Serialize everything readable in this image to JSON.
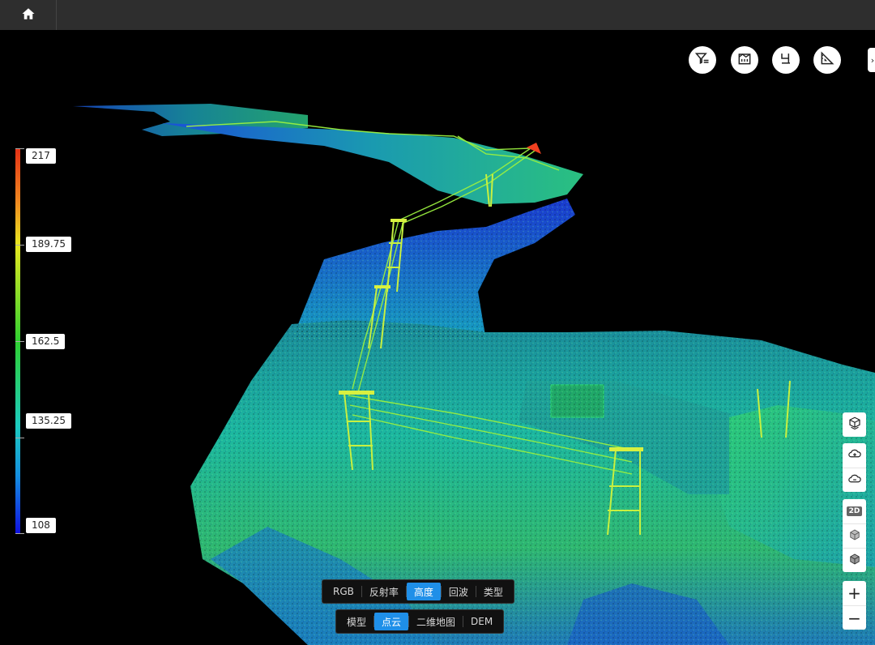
{
  "topbar": {
    "home_icon": "home-icon"
  },
  "tools": [
    {
      "name": "filter-icon"
    },
    {
      "name": "building-icon"
    },
    {
      "name": "section-icon"
    },
    {
      "name": "measure-icon"
    }
  ],
  "edge_tab": {
    "label": "›"
  },
  "legend": {
    "labels": [
      "217",
      "189.75",
      "162.5",
      "135.25",
      "108"
    ],
    "colors": [
      "#e53015",
      "#e8e820",
      "#2fd030",
      "#1ccbc0",
      "#1010e0"
    ]
  },
  "right_controls": {
    "badge_2d": "2D",
    "zoom_in": "+",
    "zoom_out": "−"
  },
  "render_modes": {
    "items": [
      "RGB",
      "反射率",
      "高度",
      "回波",
      "类型"
    ],
    "active": "高度"
  },
  "view_modes": {
    "items": [
      "模型",
      "点云",
      "二维地图",
      "DEM"
    ],
    "active": "点云"
  }
}
